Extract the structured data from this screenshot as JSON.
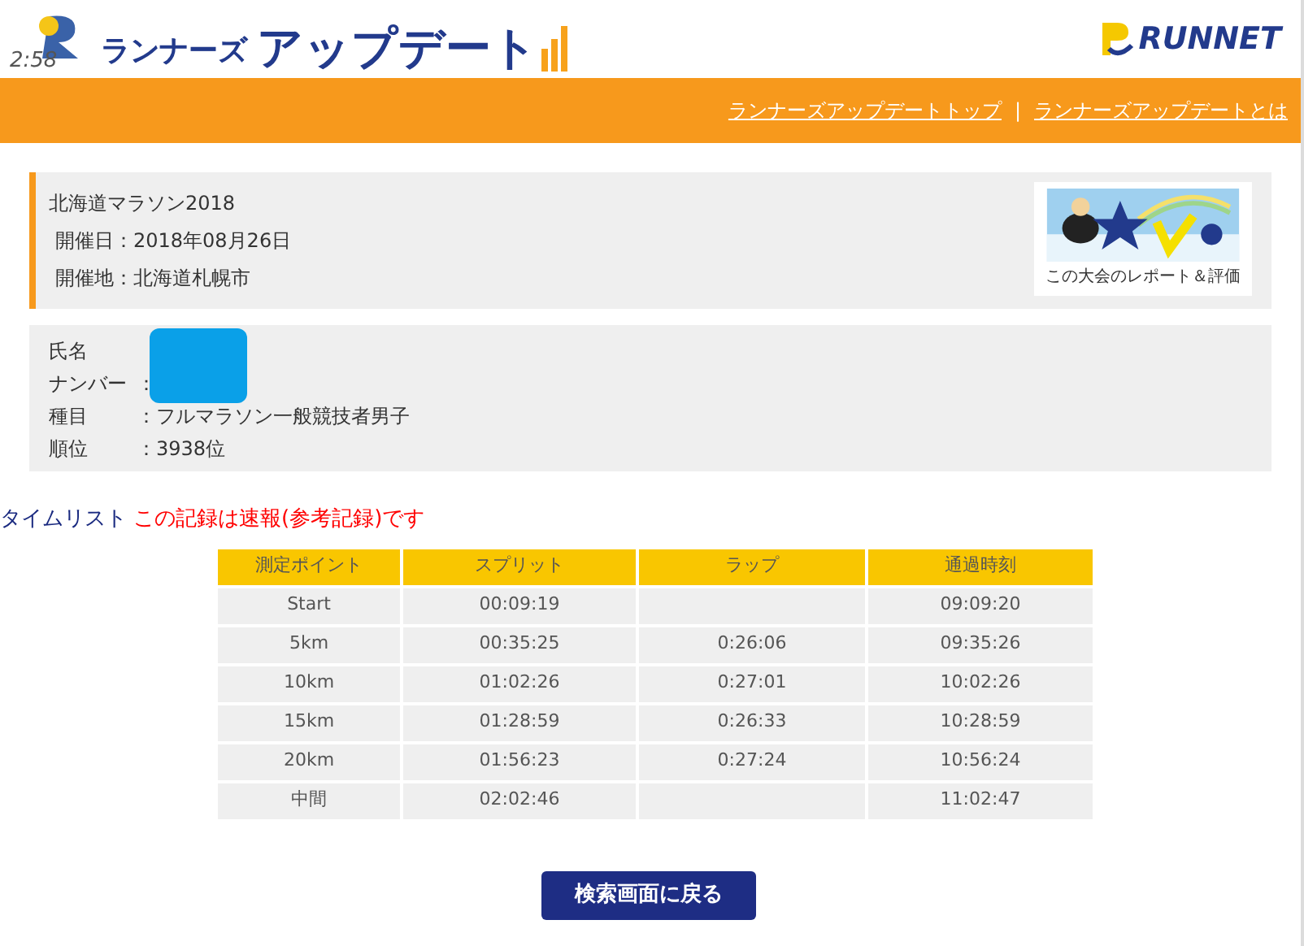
{
  "header": {
    "logo_time": "2:58",
    "logo_small": "ランナーズ",
    "logo_large": "アップデート",
    "brand": "RUNNET"
  },
  "nav": {
    "links": [
      {
        "label": "ランナーズアップデートトップ"
      },
      {
        "label": "ランナーズアップデートとは"
      }
    ],
    "separator": "|"
  },
  "race": {
    "name": "北海道マラソン2018",
    "fields": [
      {
        "label": "開催日：",
        "value": "2018年08月26日"
      },
      {
        "label": "開催地：",
        "value": "北海道札幌市"
      }
    ],
    "banner_caption": "この大会のレポート＆評価"
  },
  "runner": {
    "fields": [
      {
        "label": "氏名",
        "redacted": true
      },
      {
        "label": "ナンバー",
        "value": "：",
        "redacted": false
      },
      {
        "label": "種目",
        "value": "：フルマラソン一般競技者男子",
        "redacted": false
      },
      {
        "label": "順位",
        "value": "：3938位",
        "redacted": false
      }
    ]
  },
  "timelist": {
    "title": "タイムリスト",
    "notice": "この記録は速報(参考記録)です"
  },
  "table": {
    "columns": [
      "測定ポイント",
      "スプリット",
      "ラップ",
      "通過時刻"
    ],
    "rows": [
      [
        "Start",
        "00:09:19",
        "",
        "09:09:20"
      ],
      [
        "5km",
        "00:35:25",
        "0:26:06",
        "09:35:26"
      ],
      [
        "10km",
        "01:02:26",
        "0:27:01",
        "10:02:26"
      ],
      [
        "15km",
        "01:28:59",
        "0:26:33",
        "10:28:59"
      ],
      [
        "20km",
        "01:56:23",
        "0:27:24",
        "10:56:24"
      ],
      [
        "中間",
        "02:02:46",
        "",
        "11:02:47"
      ]
    ]
  },
  "back_button": "検索画面に戻る"
}
